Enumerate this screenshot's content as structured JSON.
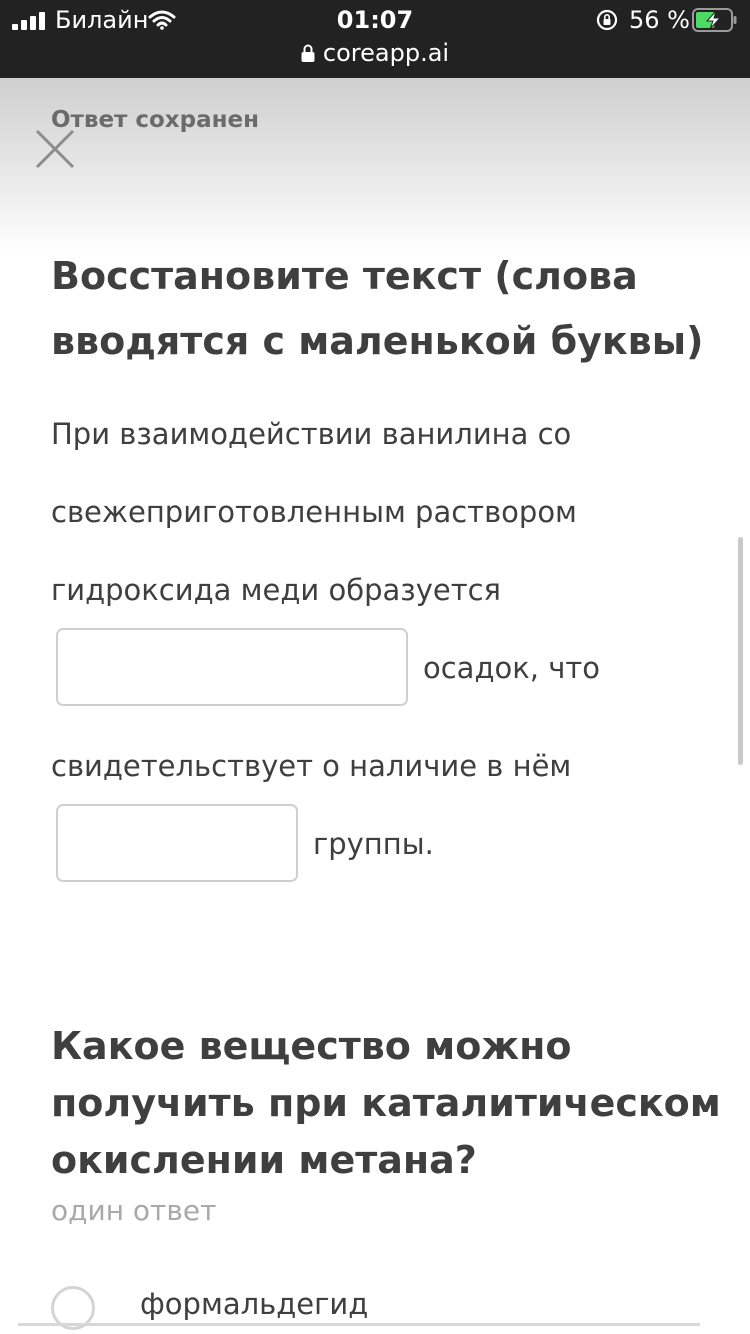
{
  "status_bar": {
    "carrier": "Билайн",
    "time": "01:07",
    "battery_percent": "56 %",
    "battery_level": 0.56,
    "url": "coreapp.ai",
    "icons": [
      "signal-icon",
      "wifi-icon",
      "rotation-lock-icon",
      "battery-charging-icon",
      "padlock-icon"
    ]
  },
  "banner": {
    "text": "Ответ сохранен",
    "close_icon": "close-icon"
  },
  "question1": {
    "title": "Восстановите текст (слова вводятся с маленькой буквы)",
    "line1": "При взаимодействии ванилина со",
    "line2": "свежеприготовленным раствором",
    "line3": "гидроксида меди образуется",
    "blank1_value": "",
    "after_blank1": "осадок, что",
    "line5": "свидетельствует о наличие в нём",
    "blank2_value": "",
    "after_blank2": "группы."
  },
  "question2": {
    "title": "Какое вещество можно получить при каталитическом окислении метана?",
    "hint": "один ответ",
    "options": [
      {
        "label": "формальдегид",
        "selected": false
      }
    ]
  },
  "colors": {
    "status_bar_bg": "#222222",
    "text": "#3f3f3f",
    "hint": "#a9a9a9",
    "input_border": "#cfcfcf",
    "battery_fill": "#4cd964"
  }
}
